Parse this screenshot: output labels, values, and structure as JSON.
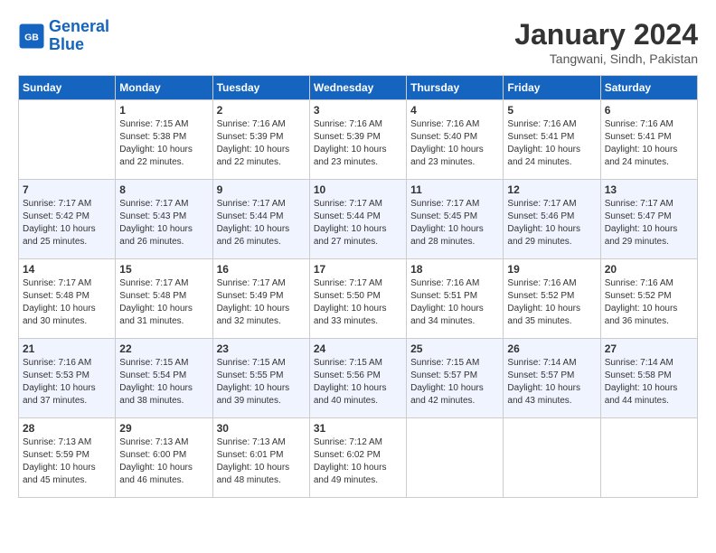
{
  "header": {
    "logo_line1": "General",
    "logo_line2": "Blue",
    "month_year": "January 2024",
    "location": "Tangwani, Sindh, Pakistan"
  },
  "days_of_week": [
    "Sunday",
    "Monday",
    "Tuesday",
    "Wednesday",
    "Thursday",
    "Friday",
    "Saturday"
  ],
  "weeks": [
    [
      {
        "day": "",
        "sunrise": "",
        "sunset": "",
        "daylight": ""
      },
      {
        "day": "1",
        "sunrise": "7:15 AM",
        "sunset": "5:38 PM",
        "daylight": "10 hours and 22 minutes."
      },
      {
        "day": "2",
        "sunrise": "7:16 AM",
        "sunset": "5:39 PM",
        "daylight": "10 hours and 22 minutes."
      },
      {
        "day": "3",
        "sunrise": "7:16 AM",
        "sunset": "5:39 PM",
        "daylight": "10 hours and 23 minutes."
      },
      {
        "day": "4",
        "sunrise": "7:16 AM",
        "sunset": "5:40 PM",
        "daylight": "10 hours and 23 minutes."
      },
      {
        "day": "5",
        "sunrise": "7:16 AM",
        "sunset": "5:41 PM",
        "daylight": "10 hours and 24 minutes."
      },
      {
        "day": "6",
        "sunrise": "7:16 AM",
        "sunset": "5:41 PM",
        "daylight": "10 hours and 24 minutes."
      }
    ],
    [
      {
        "day": "7",
        "sunrise": "7:17 AM",
        "sunset": "5:42 PM",
        "daylight": "10 hours and 25 minutes."
      },
      {
        "day": "8",
        "sunrise": "7:17 AM",
        "sunset": "5:43 PM",
        "daylight": "10 hours and 26 minutes."
      },
      {
        "day": "9",
        "sunrise": "7:17 AM",
        "sunset": "5:44 PM",
        "daylight": "10 hours and 26 minutes."
      },
      {
        "day": "10",
        "sunrise": "7:17 AM",
        "sunset": "5:44 PM",
        "daylight": "10 hours and 27 minutes."
      },
      {
        "day": "11",
        "sunrise": "7:17 AM",
        "sunset": "5:45 PM",
        "daylight": "10 hours and 28 minutes."
      },
      {
        "day": "12",
        "sunrise": "7:17 AM",
        "sunset": "5:46 PM",
        "daylight": "10 hours and 29 minutes."
      },
      {
        "day": "13",
        "sunrise": "7:17 AM",
        "sunset": "5:47 PM",
        "daylight": "10 hours and 29 minutes."
      }
    ],
    [
      {
        "day": "14",
        "sunrise": "7:17 AM",
        "sunset": "5:48 PM",
        "daylight": "10 hours and 30 minutes."
      },
      {
        "day": "15",
        "sunrise": "7:17 AM",
        "sunset": "5:48 PM",
        "daylight": "10 hours and 31 minutes."
      },
      {
        "day": "16",
        "sunrise": "7:17 AM",
        "sunset": "5:49 PM",
        "daylight": "10 hours and 32 minutes."
      },
      {
        "day": "17",
        "sunrise": "7:17 AM",
        "sunset": "5:50 PM",
        "daylight": "10 hours and 33 minutes."
      },
      {
        "day": "18",
        "sunrise": "7:16 AM",
        "sunset": "5:51 PM",
        "daylight": "10 hours and 34 minutes."
      },
      {
        "day": "19",
        "sunrise": "7:16 AM",
        "sunset": "5:52 PM",
        "daylight": "10 hours and 35 minutes."
      },
      {
        "day": "20",
        "sunrise": "7:16 AM",
        "sunset": "5:52 PM",
        "daylight": "10 hours and 36 minutes."
      }
    ],
    [
      {
        "day": "21",
        "sunrise": "7:16 AM",
        "sunset": "5:53 PM",
        "daylight": "10 hours and 37 minutes."
      },
      {
        "day": "22",
        "sunrise": "7:15 AM",
        "sunset": "5:54 PM",
        "daylight": "10 hours and 38 minutes."
      },
      {
        "day": "23",
        "sunrise": "7:15 AM",
        "sunset": "5:55 PM",
        "daylight": "10 hours and 39 minutes."
      },
      {
        "day": "24",
        "sunrise": "7:15 AM",
        "sunset": "5:56 PM",
        "daylight": "10 hours and 40 minutes."
      },
      {
        "day": "25",
        "sunrise": "7:15 AM",
        "sunset": "5:57 PM",
        "daylight": "10 hours and 42 minutes."
      },
      {
        "day": "26",
        "sunrise": "7:14 AM",
        "sunset": "5:57 PM",
        "daylight": "10 hours and 43 minutes."
      },
      {
        "day": "27",
        "sunrise": "7:14 AM",
        "sunset": "5:58 PM",
        "daylight": "10 hours and 44 minutes."
      }
    ],
    [
      {
        "day": "28",
        "sunrise": "7:13 AM",
        "sunset": "5:59 PM",
        "daylight": "10 hours and 45 minutes."
      },
      {
        "day": "29",
        "sunrise": "7:13 AM",
        "sunset": "6:00 PM",
        "daylight": "10 hours and 46 minutes."
      },
      {
        "day": "30",
        "sunrise": "7:13 AM",
        "sunset": "6:01 PM",
        "daylight": "10 hours and 48 minutes."
      },
      {
        "day": "31",
        "sunrise": "7:12 AM",
        "sunset": "6:02 PM",
        "daylight": "10 hours and 49 minutes."
      },
      {
        "day": "",
        "sunrise": "",
        "sunset": "",
        "daylight": ""
      },
      {
        "day": "",
        "sunrise": "",
        "sunset": "",
        "daylight": ""
      },
      {
        "day": "",
        "sunrise": "",
        "sunset": "",
        "daylight": ""
      }
    ]
  ]
}
